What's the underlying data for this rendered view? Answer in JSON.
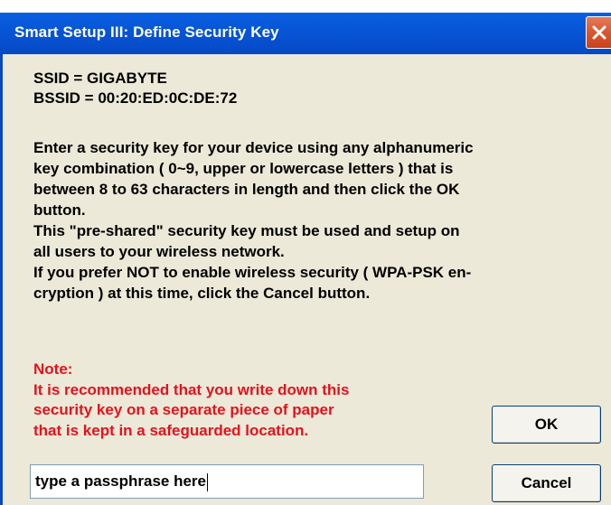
{
  "window": {
    "title": "Smart Setup III: Define Security Key"
  },
  "info": {
    "ssid": "SSID = GIGABYTE",
    "bssid": "BSSID = 00:20:ED:0C:DE:72"
  },
  "instructions": [
    "Enter a security key for your device using any alphanumeric",
    "key combination ( 0~9, upper or lowercase letters )  that is",
    "between 8 to 63 characters in length and then click the  OK",
    "button.",
    "This \"pre-shared\" security key must be used and setup  on",
    "all users to your wireless network.",
    "If you prefer NOT to enable wireless security ( WPA-PSK en-",
    "cryption ) at this time, click the Cancel button."
  ],
  "note": {
    "heading": "Note:",
    "lines": [
      "It is recommended that you write down this",
      "security key on a separate piece of   paper",
      "that is kept in a safeguarded  location."
    ]
  },
  "passphrase": {
    "value": "type a passphrase here"
  },
  "buttons": {
    "ok_label": "OK",
    "cancel_label": "Cancel"
  },
  "icons": {
    "close": "close-icon"
  },
  "colors": {
    "titlebar": "#0549c3",
    "note_text": "#e8101b",
    "dialog_bg": "#ece9d8",
    "close_button": "#d9572f"
  }
}
